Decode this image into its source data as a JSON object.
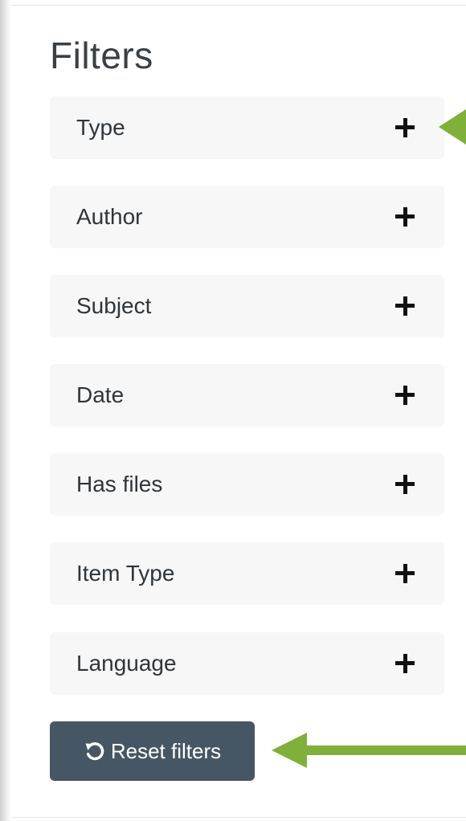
{
  "panel": {
    "title": "Filters"
  },
  "filters": [
    {
      "label": "Type"
    },
    {
      "label": "Author"
    },
    {
      "label": "Subject"
    },
    {
      "label": "Date"
    },
    {
      "label": "Has files"
    },
    {
      "label": "Item Type"
    },
    {
      "label": "Language"
    }
  ],
  "reset_button": {
    "label": "Reset filters",
    "icon": "undo-icon"
  },
  "colors": {
    "panel_bg": "#ffffff",
    "filter_bg": "#f7f7f8",
    "button_bg": "#465664",
    "annotation_arrow": "#7fb13a"
  },
  "icons": {
    "expand": "plus-icon",
    "annotation": "arrow-pointer"
  }
}
